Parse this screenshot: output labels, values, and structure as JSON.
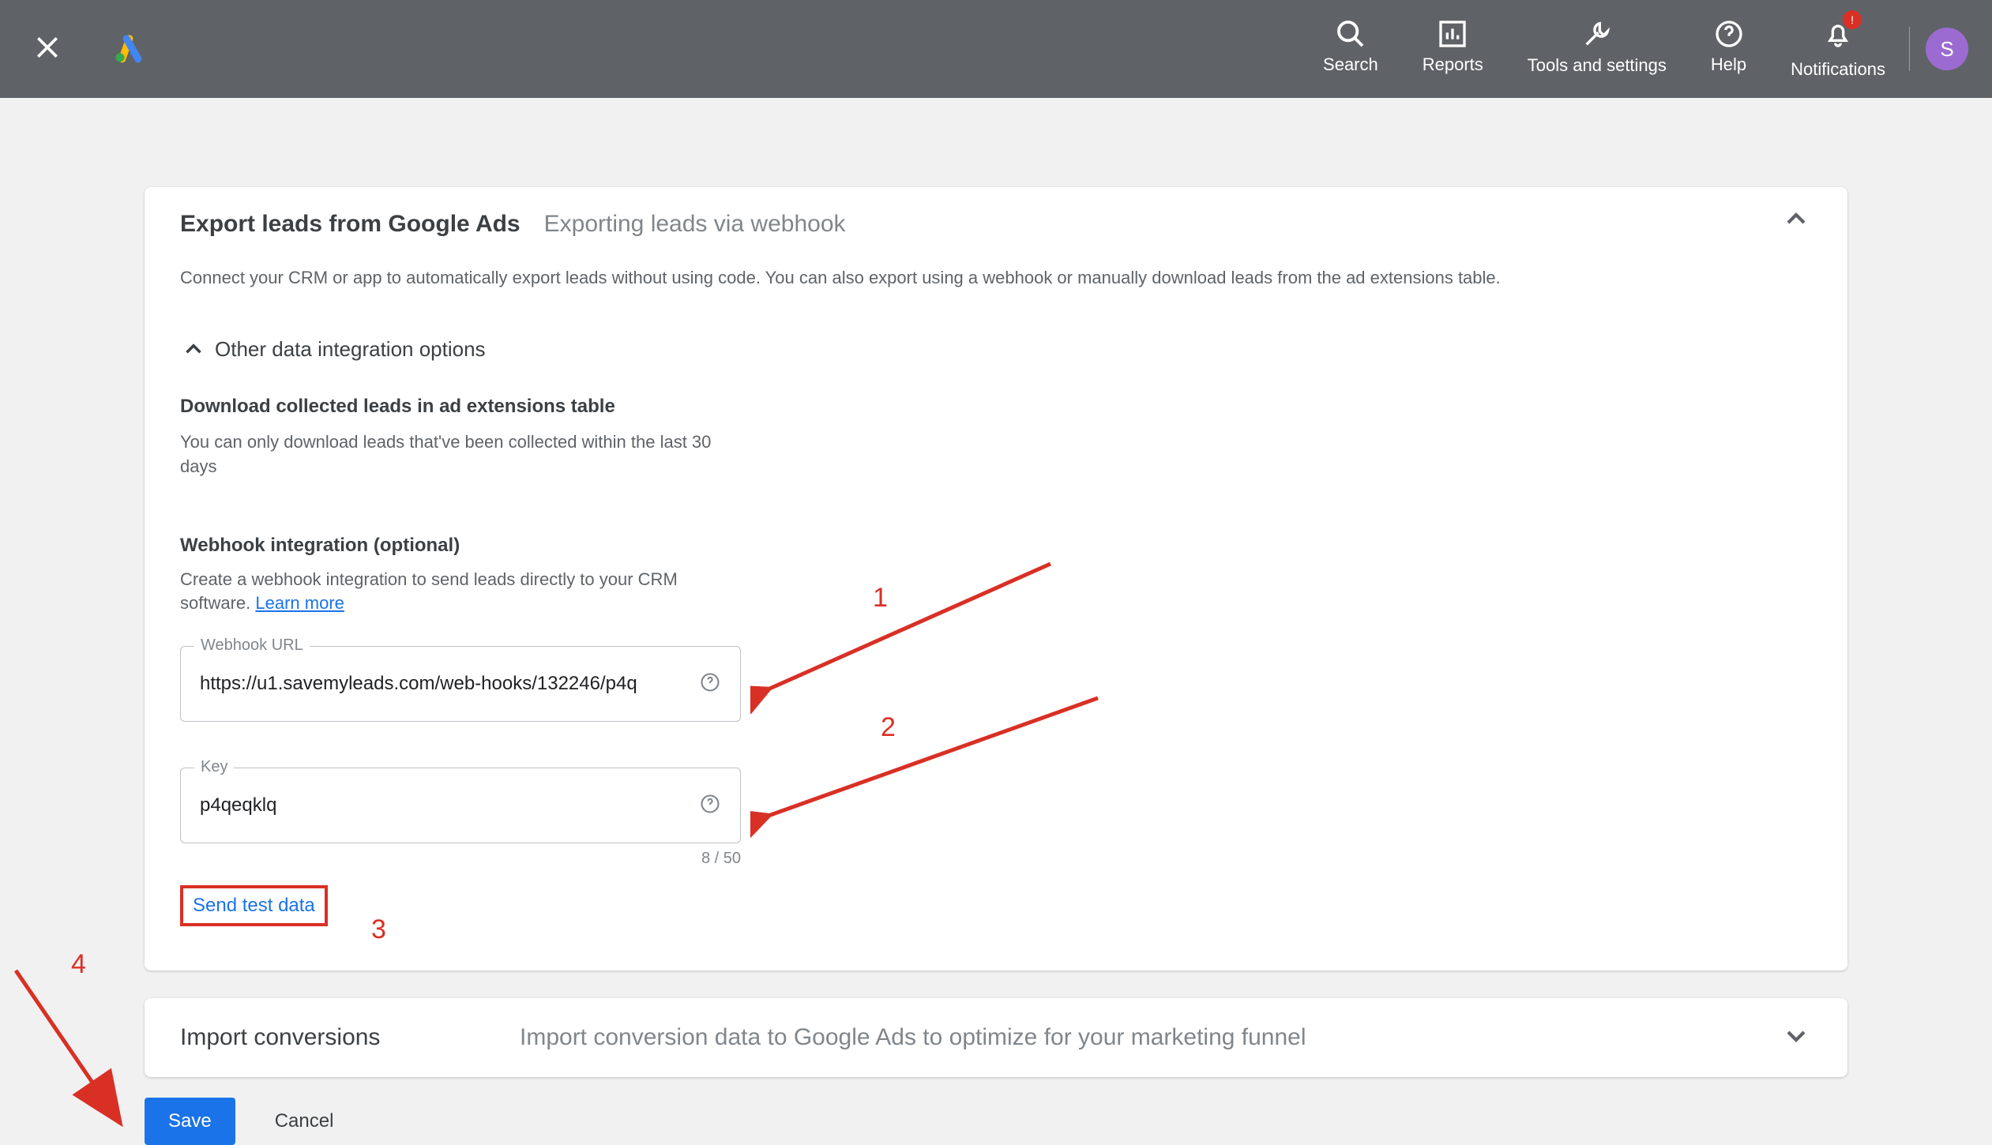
{
  "topbar": {
    "search": "Search",
    "reports": "Reports",
    "tools": "Tools and settings",
    "help": "Help",
    "notifications": "Notifications",
    "badge": "!",
    "avatar_initial": "S"
  },
  "card": {
    "title": "Export leads from Google Ads",
    "subtitle": "Exporting leads via webhook",
    "description": "Connect your CRM or app to automatically export leads without using code. You can also export using a webhook or manually download leads from the ad extensions table.",
    "other_options": "Other data integration options",
    "download_title": "Download collected leads in ad extensions table",
    "download_desc": "You can only download leads that've been collected within the last 30 days",
    "webhook_title": "Webhook integration (optional)",
    "webhook_desc_pre": "Create a webhook integration to send leads directly to your CRM software. ",
    "webhook_learn": "Learn more",
    "url_label": "Webhook URL",
    "url_value": "https://u1.savemyleads.com/web-hooks/132246/p4q",
    "key_label": "Key",
    "key_value": "p4qeqklq",
    "key_counter": "8 / 50",
    "send_test": "Send test data"
  },
  "import": {
    "title": "Import conversions",
    "desc": "Import conversion data to Google Ads to optimize for your marketing funnel"
  },
  "buttons": {
    "save": "Save",
    "cancel": "Cancel"
  },
  "anno": {
    "n1": "1",
    "n2": "2",
    "n3": "3",
    "n4": "4"
  }
}
